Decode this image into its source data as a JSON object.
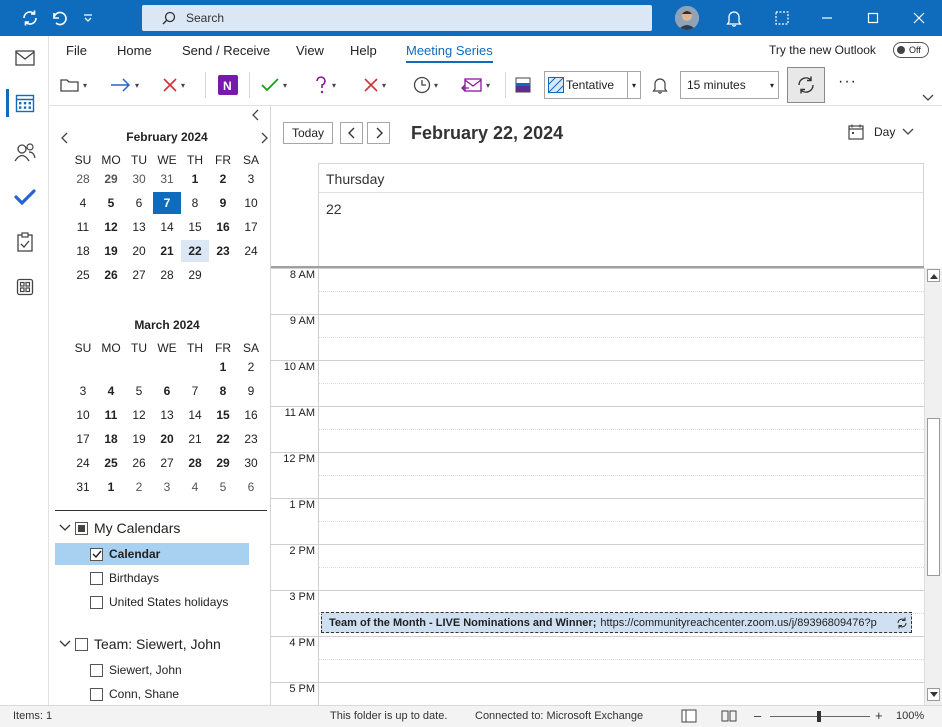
{
  "titlebar": {
    "search_placeholder": "Search",
    "icons": [
      "sync-icon",
      "undo-icon",
      "customize-qat-icon",
      "search-icon",
      "avatar",
      "bell-icon",
      "window-mode-icon"
    ]
  },
  "ribbon": {
    "menus": [
      "File",
      "Home",
      "Send / Receive",
      "View",
      "Help",
      "Meeting Series"
    ],
    "active_menu": "Meeting Series",
    "try_new_outlook": "Try the new Outlook",
    "toggle_label": "Off",
    "response_value": "Tentative",
    "reminder_value": "15 minutes",
    "more": "···"
  },
  "mini_calendar": {
    "weekdays": [
      "SU",
      "MO",
      "TU",
      "WE",
      "TH",
      "FR",
      "SA"
    ],
    "months": [
      {
        "title": "February 2024",
        "weeks": [
          [
            "28",
            "29",
            "30",
            "31",
            "1",
            "2",
            "3"
          ],
          [
            "4",
            "5",
            "6",
            "7",
            "8",
            "9",
            "10"
          ],
          [
            "11",
            "12",
            "13",
            "14",
            "15",
            "16",
            "17"
          ],
          [
            "18",
            "19",
            "20",
            "21",
            "22",
            "23",
            "24"
          ],
          [
            "25",
            "26",
            "27",
            "28",
            "29",
            "",
            ""
          ]
        ]
      },
      {
        "title": "March 2024",
        "weeks": [
          [
            "",
            "",
            "",
            "",
            "",
            "1",
            "2"
          ],
          [
            "3",
            "4",
            "5",
            "6",
            "7",
            "8",
            "9"
          ],
          [
            "10",
            "11",
            "12",
            "13",
            "14",
            "15",
            "16"
          ],
          [
            "17",
            "18",
            "19",
            "20",
            "21",
            "22",
            "23"
          ],
          [
            "24",
            "25",
            "26",
            "27",
            "28",
            "29",
            "30"
          ],
          [
            "31",
            "1",
            "2",
            "3",
            "4",
            "5",
            "6"
          ]
        ]
      }
    ]
  },
  "calendars": {
    "my_calendars": "My Calendars",
    "items": [
      "Calendar",
      "Birthdays",
      "United States holidays"
    ],
    "team": "Team: Siewert, John",
    "team_items": [
      "Siewert, John",
      "Conn, Shane"
    ]
  },
  "day_view": {
    "today_btn": "Today",
    "date_title": "February 22, 2024",
    "view_label": "Day",
    "weekday": "Thursday",
    "daynum": "22",
    "hours": [
      "8 AM",
      "9 AM",
      "10 AM",
      "11 AM",
      "12 PM",
      "1 PM",
      "2 PM",
      "3 PM",
      "4 PM",
      "5 PM"
    ],
    "event_title": "Team of the Month - LIVE Nominations and Winner;",
    "event_link": "https://communityreachcenter.zoom.us/j/89396809476?p"
  },
  "status": {
    "items": "Items: 1",
    "folder": "This folder is up to date.",
    "connection": "Connected to: Microsoft Exchange",
    "zoom": "100%"
  }
}
